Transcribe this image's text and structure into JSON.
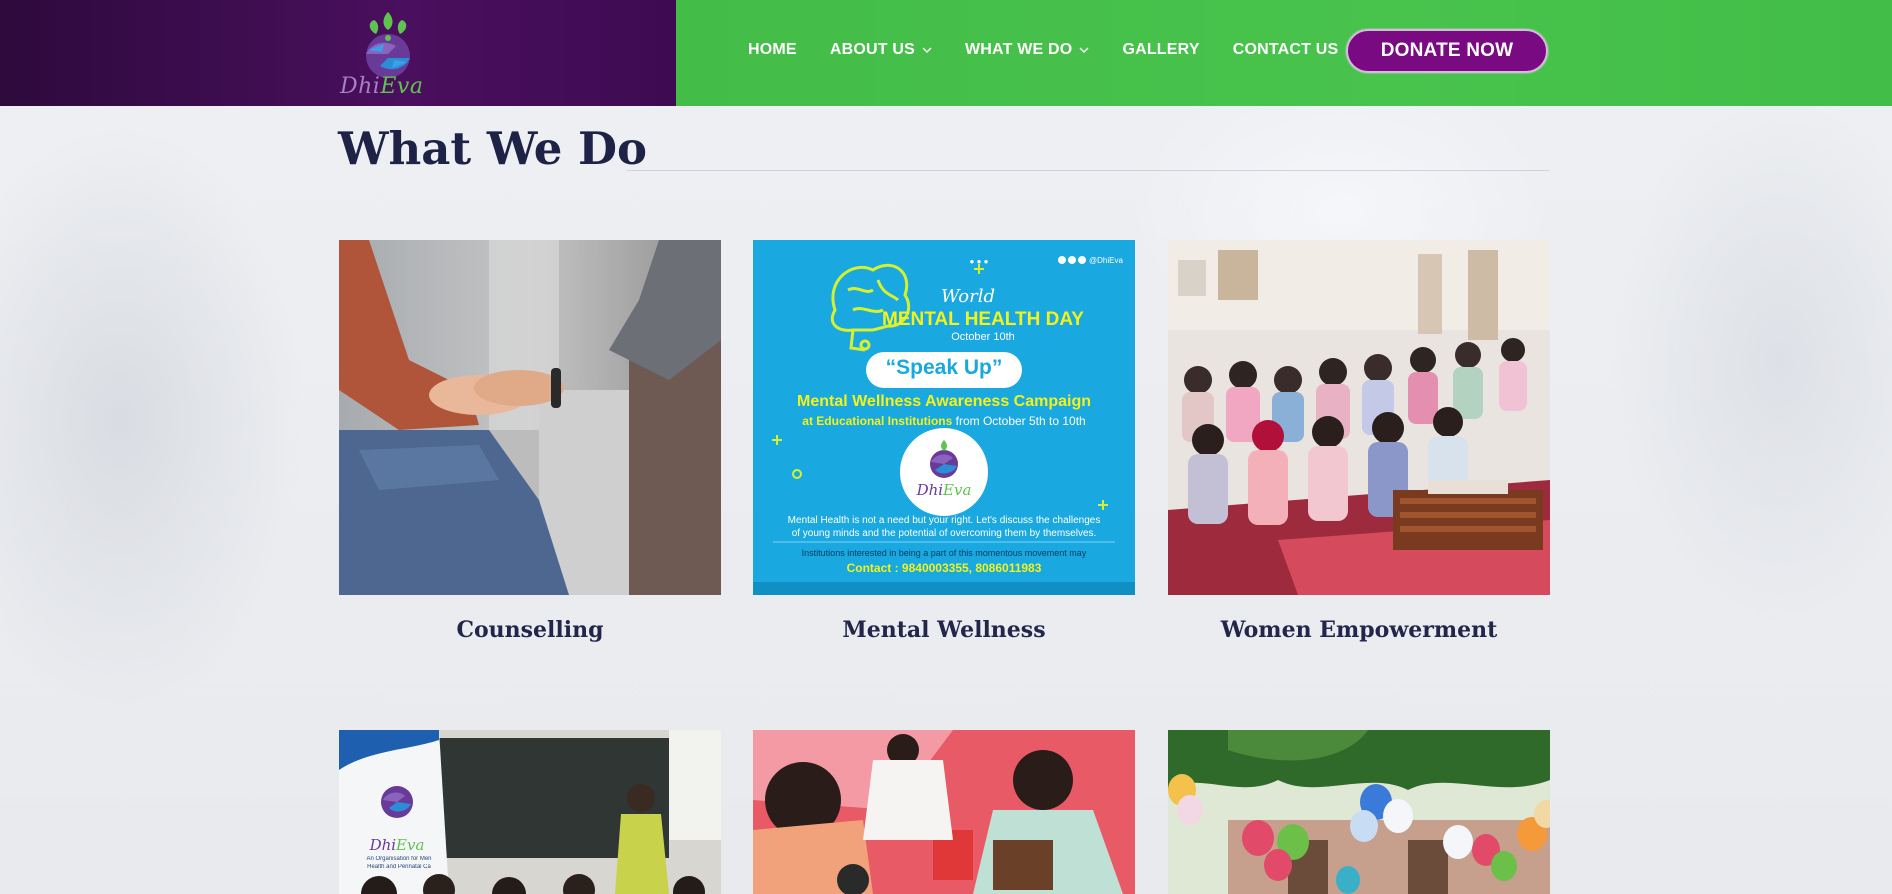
{
  "brand": {
    "name_part1": "Dhi",
    "name_part2": "Eva",
    "colors": {
      "purple": "#4a0f5e",
      "green": "#48c34c",
      "donate": "#7a0a82",
      "navy": "#1f2247"
    }
  },
  "nav": {
    "items": [
      {
        "label": "HOME",
        "dropdown": false
      },
      {
        "label": "ABOUT US",
        "dropdown": true
      },
      {
        "label": "WHAT WE DO",
        "dropdown": true
      },
      {
        "label": "GALLERY",
        "dropdown": false
      },
      {
        "label": "CONTACT US",
        "dropdown": false
      }
    ],
    "donate_label": "DONATE NOW"
  },
  "page": {
    "title": "What We Do"
  },
  "cards": [
    {
      "label": "Counselling"
    },
    {
      "label": "Mental Wellness"
    },
    {
      "label": "Women Empowerment"
    },
    {
      "label": ""
    },
    {
      "label": ""
    },
    {
      "label": ""
    }
  ],
  "poster": {
    "social_handle": "@DhiEva",
    "world": "World",
    "headline": "MENTAL HEALTH DAY",
    "date": "October 10th",
    "speak_up": "“Speak Up”",
    "campaign": "Mental Wellness Awareness Campaign",
    "institutions_prefix": "at Educational Institutions",
    "institutions_suffix": "from October 5th to 10th",
    "logo_dhi": "Dhi",
    "logo_eva": "Eva",
    "body_line1": "Mental Health is not a need but your right. Let's discuss the challenges",
    "body_line2": "of young minds and the potential of overcoming them by themselves.",
    "footer_line": "Institutions interested in being a part of this momentous movement may",
    "contact": "Contact : 9840003355, 8086011983"
  },
  "class_banner": {
    "logo_dhi": "Dhi",
    "logo_eva": "Eva",
    "tagline1": "An Organisation for Men",
    "tagline2": "Health and Perinatal Ca"
  }
}
